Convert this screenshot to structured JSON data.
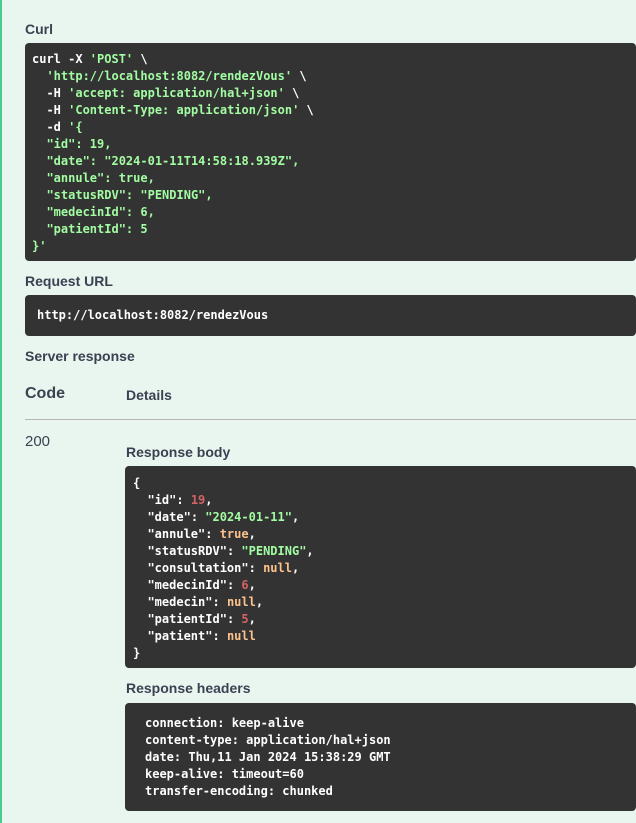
{
  "labels": {
    "curl": "Curl",
    "request_url": "Request URL",
    "server_response": "Server response",
    "code_header": "Code",
    "details_header": "Details",
    "response_body": "Response body",
    "response_headers": "Response headers"
  },
  "curl": {
    "l1a": "curl -X ",
    "l1b": "'POST'",
    "l1c": " \\",
    "l2a": "  ",
    "l2b": "'http://localhost:8082/rendezVous'",
    "l2c": " \\",
    "l3a": "  -H ",
    "l3b": "'accept: application/hal+json'",
    "l3c": " \\",
    "l4a": "  -H ",
    "l4b": "'Content-Type: application/json'",
    "l4c": " \\",
    "l5a": "  -d ",
    "l5b": "'{",
    "l6": "  \"id\": 19,",
    "l7": "  \"date\": \"2024-01-11T14:58:18.939Z\",",
    "l8": "  \"annule\": true,",
    "l9": "  \"statusRDV\": \"PENDING\",",
    "l10": "  \"medecinId\": 6,",
    "l11": "  \"patientId\": 5",
    "l12": "}'"
  },
  "request_url": "http://localhost:8082/rendezVous",
  "response": {
    "code": "200",
    "body": {
      "id": "19",
      "date": "\"2024-01-11\"",
      "annule": "true",
      "statusRDV": "\"PENDING\"",
      "consultation": "null",
      "medecinId": "6",
      "medecin": "null",
      "patientId": "5",
      "patient": "null"
    },
    "headers": [
      "connection: keep-alive",
      "content-type: application/hal+json",
      "date: Thu,11 Jan 2024 15:38:29 GMT",
      "keep-alive: timeout=60",
      "transfer-encoding: chunked"
    ]
  },
  "colors": {
    "accent": "#49cc90",
    "code_bg": "#333333",
    "string": "#a2fca2",
    "keyword": "#fcc28c",
    "number": "#d36363"
  }
}
